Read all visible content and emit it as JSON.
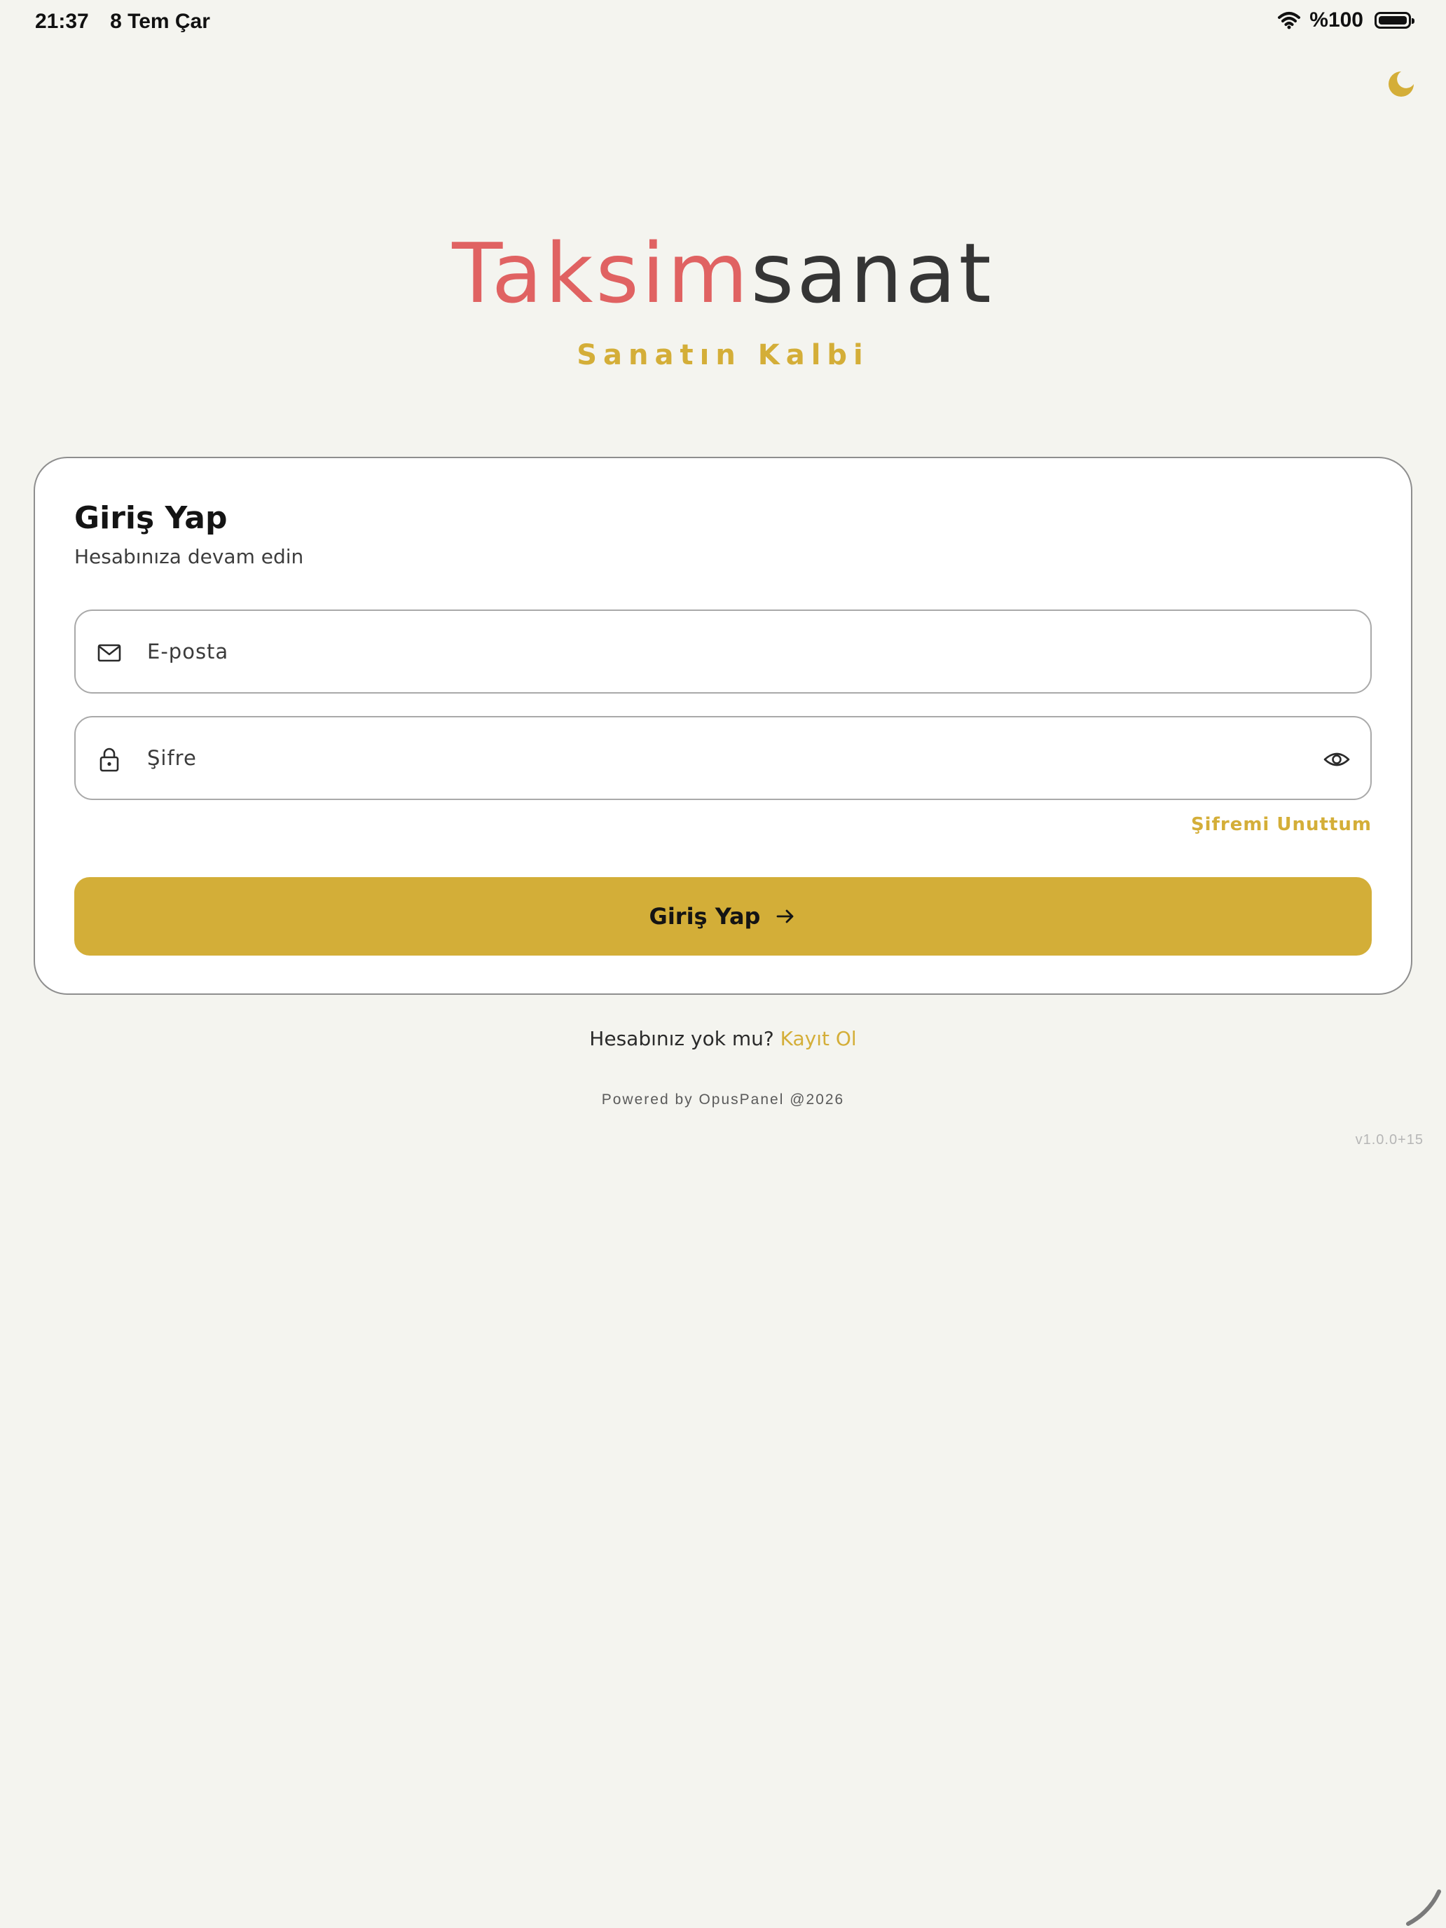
{
  "status_bar": {
    "time": "21:37",
    "date": "8 Tem Çar",
    "battery": "%100"
  },
  "brand": {
    "title_accent": "Taksim",
    "title_main": "sanat",
    "tagline": "Sanatın Kalbi"
  },
  "login": {
    "title": "Giriş Yap",
    "subtitle": "Hesabınıza devam edin",
    "email_placeholder": "E-posta",
    "password_placeholder": "Şifre",
    "forgot_label": "Şifremi Unuttum",
    "submit_label": "Giriş Yap"
  },
  "signup": {
    "prompt": "Hesabınız yok mu?",
    "link_label": "Kayıt Ol"
  },
  "footer": {
    "powered_by": "Powered by OpusPanel @2026",
    "version": "v1.0.0+15"
  },
  "icons": {
    "theme_toggle": "moon-icon",
    "email": "mail-icon",
    "password": "lock-icon",
    "show_password": "eye-icon",
    "submit": "arrow-right-icon"
  },
  "colors": {
    "background": "#f4f4ef",
    "accent_gold": "#d3ae38",
    "brand_red": "#e06262",
    "brand_dark": "#353535",
    "card_border": "#8e8e8e"
  }
}
